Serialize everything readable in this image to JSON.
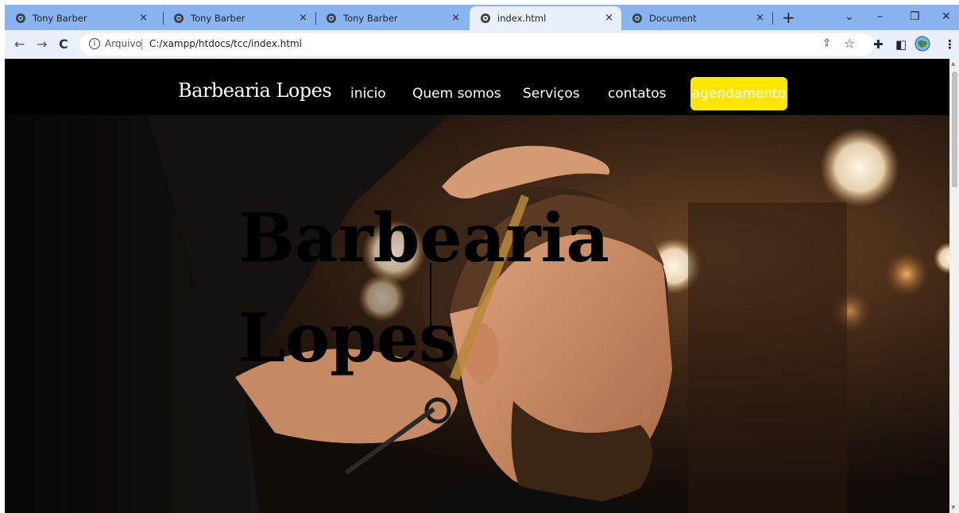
{
  "browser": {
    "tabs": [
      {
        "title": "Tony Barber",
        "active": false
      },
      {
        "title": "Tony Barber",
        "active": false
      },
      {
        "title": "Tony Barber",
        "active": false
      },
      {
        "title": "index.html",
        "active": true
      },
      {
        "title": "Document",
        "active": false
      }
    ],
    "close_glyph": "×",
    "new_tab_glyph": "+",
    "window_controls": {
      "tab_search": "⌄",
      "minimize": "–",
      "restore": "❐",
      "close": "✕"
    },
    "toolbar": {
      "back": "←",
      "forward": "→",
      "reload": "C",
      "info_glyph": "i",
      "security_label": "Arquivo",
      "url": "C:/xampp/htdocs/tcc/index.html",
      "share_glyph": "⇪",
      "star_glyph": "☆",
      "extensions_glyph": "✚",
      "sidepanel_glyph": "◧",
      "menu_glyph": "⋮"
    }
  },
  "site": {
    "brand": "Barbearia Lopes",
    "nav": [
      "inicio",
      "Quem somos",
      "Serviços",
      "contatos"
    ],
    "cta": "agendamento",
    "hero_title_line1": "Barbearia",
    "hero_title_line2": "Lopes"
  },
  "colors": {
    "tabstrip": "#8ab4f0",
    "toolbar": "#e9f0fb",
    "cta_bg": "#ffe600",
    "nav_bg": "#000000"
  }
}
